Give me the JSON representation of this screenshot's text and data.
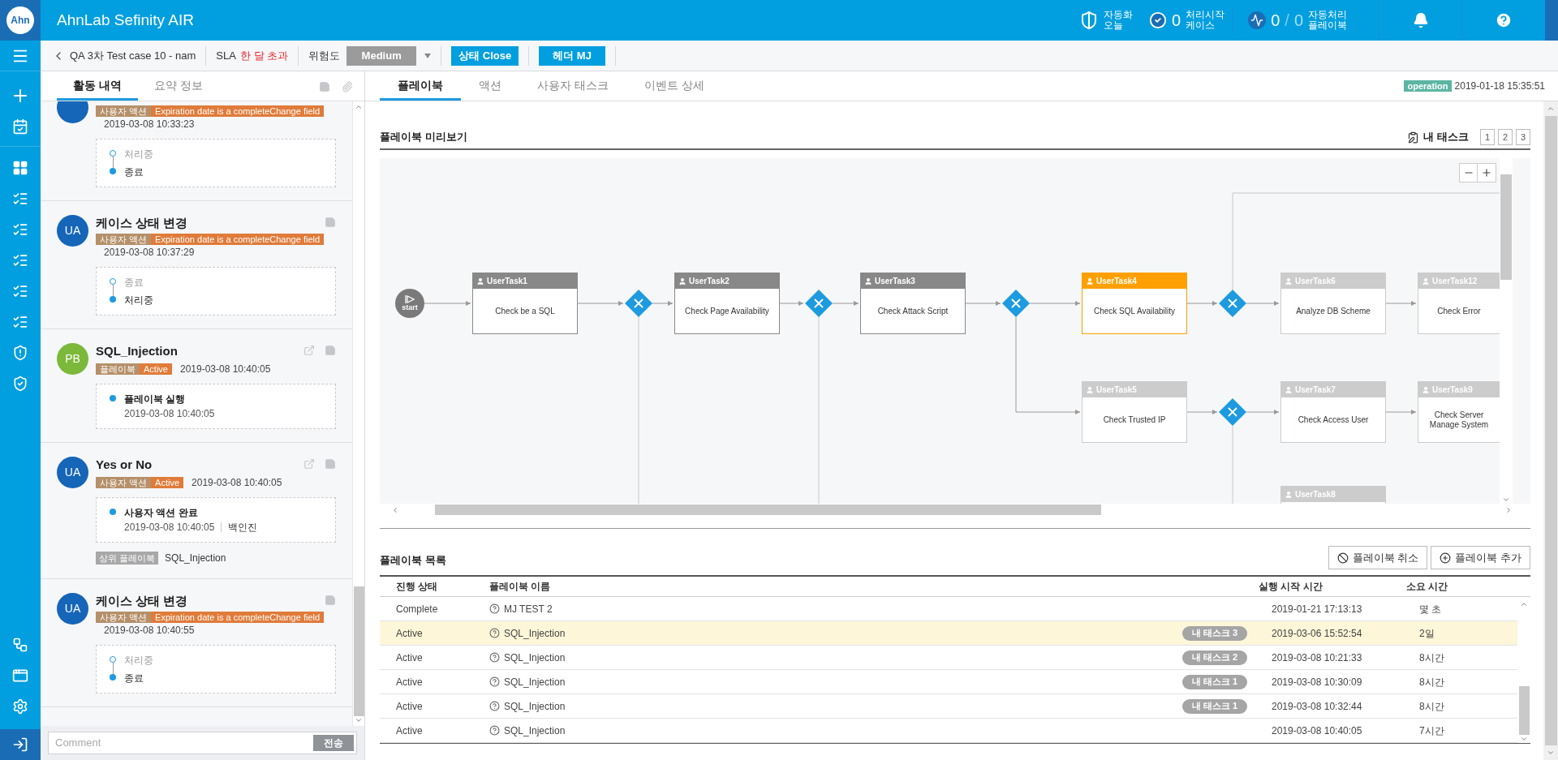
{
  "app": {
    "logo": "Ahn",
    "title": "AhnLab Sefinity AIR"
  },
  "header_stats": [
    {
      "kind": "shield",
      "lines": [
        "자동화",
        "오늘"
      ]
    },
    {
      "kind": "check",
      "value": "0",
      "lines": [
        "처리시작",
        "케이스"
      ]
    },
    {
      "kind": "pulse",
      "value": "0",
      "separator": "/",
      "total": "0",
      "lines": [
        "자동처리",
        "플레이북"
      ]
    }
  ],
  "case_bar": {
    "title": "QA 3차 Test case 10 - nam",
    "sla_label": "SLA",
    "sla_value": "한 달 초과",
    "risk_label": "위험도",
    "risk_value": "Medium",
    "status_button": "상태 Close",
    "owner_button": "헤더 MJ"
  },
  "left_tabs": [
    {
      "label": "활동 내역",
      "selected": true
    },
    {
      "label": "요약 정보",
      "selected": false
    }
  ],
  "activities": [
    {
      "avatar": {
        "color": "#1565b8"
      },
      "tags": [
        {
          "kind": "type",
          "text": "사용자 액션"
        },
        {
          "kind": "state",
          "text": "Expiration date is a completeChange field"
        }
      ],
      "time": "2019-03-08 10:33:23",
      "note": false,
      "export": false,
      "steps": [
        {
          "label": "처리중",
          "current": false
        },
        {
          "label": "종료",
          "current": true
        }
      ]
    },
    {
      "avatar": {
        "initials": "UA",
        "color": "#1565b8"
      },
      "title": "케이스 상태 변경",
      "tags": [
        {
          "kind": "type",
          "text": "사용자 액션"
        },
        {
          "kind": "state",
          "text": "Expiration date is a completeChange field"
        }
      ],
      "time": "2019-03-08 10:37:29",
      "note": true,
      "export": false,
      "steps": [
        {
          "label": "종료",
          "current": false
        },
        {
          "label": "처리중",
          "current": true
        }
      ]
    },
    {
      "avatar": {
        "initials": "PB",
        "color": "#7cb83a"
      },
      "title": "SQL_Injection",
      "tags": [
        {
          "kind": "type",
          "text": "플레이북"
        },
        {
          "kind": "state",
          "text": "Active"
        }
      ],
      "time": "2019-03-08 10:40:05",
      "note": true,
      "export": true,
      "steps": [
        {
          "label": "플레이북 실행",
          "current": true,
          "time": "2019-03-08 10:40:05"
        }
      ]
    },
    {
      "avatar": {
        "initials": "UA",
        "color": "#1565b8"
      },
      "title": "Yes or No",
      "tags": [
        {
          "kind": "type",
          "text": "사용자 액션"
        },
        {
          "kind": "state",
          "text": "Active"
        }
      ],
      "time": "2019-03-08 10:40:05",
      "note": true,
      "export": true,
      "steps": [
        {
          "label": "사용자 액션 완료",
          "current": true,
          "time": "2019-03-08 10:40:05",
          "user": "백인진"
        }
      ],
      "parent": {
        "label": "상위 플레이북",
        "name": "SQL_Injection"
      }
    },
    {
      "avatar": {
        "initials": "UA",
        "color": "#1565b8"
      },
      "title": "케이스 상태 변경",
      "tags": [
        {
          "kind": "type",
          "text": "사용자 액션"
        },
        {
          "kind": "state",
          "text": "Expiration date is a completeChange field"
        }
      ],
      "time": "2019-03-08 10:40:55",
      "note": true,
      "export": false,
      "steps": [
        {
          "label": "처리중",
          "current": false
        },
        {
          "label": "종료",
          "current": true
        }
      ]
    }
  ],
  "comment": {
    "placeholder": "Comment",
    "button": "전송",
    "disabled": true
  },
  "right_tabs": [
    {
      "label": "플레이북",
      "selected": true
    },
    {
      "label": "액션",
      "selected": false
    },
    {
      "label": "사용자 태스크",
      "selected": false
    },
    {
      "label": "이벤트 상세",
      "selected": false
    }
  ],
  "run_info": {
    "badge": "operation",
    "time": "2019-01-18 15:35:51"
  },
  "preview": {
    "title": "플레이북 미리보기",
    "my_task_label": "내 태스크",
    "pages": [
      {
        "label": "1",
        "selected": false
      },
      {
        "label": "2",
        "selected": false
      },
      {
        "label": "3",
        "selected": false
      }
    ]
  },
  "diagram_nodes": [
    {
      "kind": "start",
      "label": "start"
    },
    {
      "kind": "task",
      "name": "UserTask1",
      "text": "Check be a SQL",
      "color": "#888888"
    },
    {
      "kind": "gateway"
    },
    {
      "kind": "task",
      "name": "UserTask2",
      "text": "Check Page Availability",
      "color": "#888888"
    },
    {
      "kind": "gateway"
    },
    {
      "kind": "task",
      "name": "UserTask3",
      "text": "Check Attack Script",
      "color": "#888888"
    },
    {
      "kind": "gateway"
    },
    {
      "kind": "task",
      "name": "UserTask4",
      "text": "Check SQL Availability",
      "color": "#ffa000"
    },
    {
      "kind": "gateway"
    },
    {
      "kind": "task",
      "name": "UserTask6",
      "text": "Analyze DB Scheme",
      "color": "#cccccc"
    },
    {
      "kind": "task",
      "name": "UserTask12",
      "text": "Check Error",
      "color": "#cccccc"
    },
    {
      "kind": "task",
      "name": "UserTask5",
      "text": "Check Trusted IP",
      "color": "#cccccc"
    },
    {
      "kind": "gateway"
    },
    {
      "kind": "task",
      "name": "UserTask7",
      "text": "Check Access User",
      "color": "#cccccc"
    },
    {
      "kind": "task",
      "name": "UserTask9",
      "text": "Check Server Manage System",
      "color": "#cccccc"
    },
    {
      "kind": "task",
      "name": "UserTask8",
      "color": "#cccccc"
    }
  ],
  "playbook_list": {
    "title": "플레이북 목록",
    "buttons": [
      {
        "kind": "cancel",
        "label": "플레이북 취소"
      },
      {
        "kind": "add",
        "label": "플레이북 추가"
      }
    ],
    "columns": [
      "진행 상태",
      "플레이북 이름",
      "실행 시작 시간",
      "소요 시간"
    ],
    "rows": [
      {
        "status": "Complete",
        "name": "MJ TEST 2",
        "started": "2019-01-21 17:13:13",
        "duration": "몇 초",
        "selected": false
      },
      {
        "status": "Active",
        "name": "SQL_Injection",
        "my_task": "내 태스크 3",
        "started": "2019-03-06 15:52:54",
        "duration": "2일",
        "selected": true
      },
      {
        "status": "Active",
        "name": "SQL_Injection",
        "my_task": "내 태스크 2",
        "started": "2019-03-08 10:21:33",
        "duration": "8시간",
        "selected": false
      },
      {
        "status": "Active",
        "name": "SQL_Injection",
        "my_task": "내 태스크 1",
        "started": "2019-03-08 10:30:09",
        "duration": "8시간",
        "selected": false
      },
      {
        "status": "Active",
        "name": "SQL_Injection",
        "my_task": "내 태스크 1",
        "started": "2019-03-08 10:32:44",
        "duration": "8시간",
        "selected": false
      },
      {
        "status": "Active",
        "name": "SQL_Injection",
        "started": "2019-03-08 10:40:05",
        "duration": "7시간",
        "selected": false
      }
    ]
  }
}
